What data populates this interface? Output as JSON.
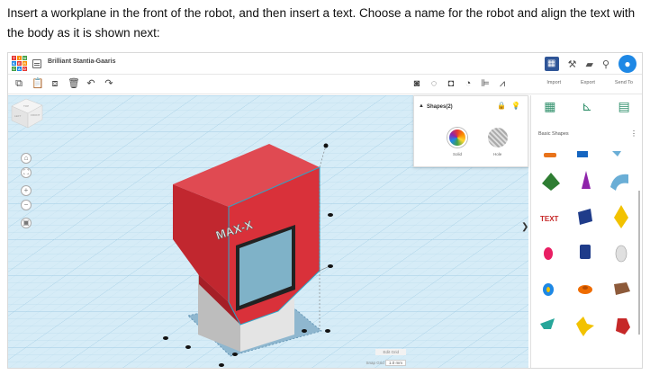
{
  "instruction": {
    "text": "Insert a workplane in the front of the robot, and then insert a text. Choose a name for the robot and align the text with the body as it is shown next:"
  },
  "titlebar": {
    "logo_letters": [
      "T",
      "I",
      "N",
      "K",
      "E",
      "R",
      "C",
      "A",
      "D"
    ],
    "project_name": "Brilliant Stantia-Gaaris"
  },
  "toolbar": {
    "import_label": "Import",
    "export_label": "Export",
    "send_to_label": "Send To"
  },
  "inspector": {
    "title": "Shapes(2)",
    "solid_label": "Solid",
    "hole_label": "Hole"
  },
  "viewcube": {
    "top_label": "TOP",
    "left_label": "LEFT",
    "front_label": "FRONT"
  },
  "right_panel": {
    "category": "Basic Shapes"
  },
  "scene": {
    "robot_text": "MAX-X",
    "workplane_label": "FRONT"
  },
  "snap": {
    "edit_grid_label": "Edit Grid",
    "snap_grid_label": "Snap Grid",
    "snap_grid_value": "1.0 mm"
  },
  "colors": {
    "accent": "#1e88e5",
    "robot_red": "#d9313a",
    "workplane_blue": "#4da3c9",
    "grid_bg": "#d6ecf7"
  }
}
